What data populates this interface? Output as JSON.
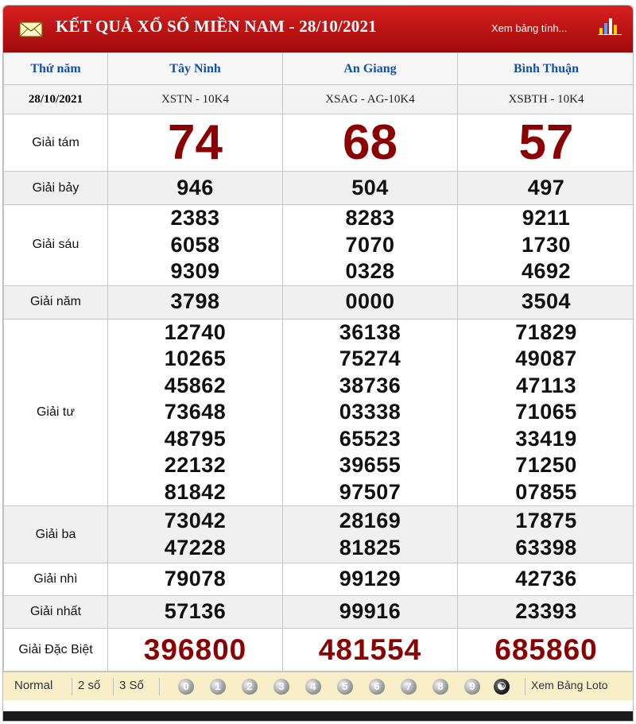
{
  "header": {
    "title": "KẾT QUẢ XỔ SỐ MIỀN NAM - 28/10/2021",
    "link": "Xem bảng tính...",
    "icons": {
      "left": "mail-icon",
      "right": "bar-chart-icon"
    }
  },
  "columns": {
    "day": "Thứ năm",
    "date": "28/10/2021",
    "provinces": [
      {
        "name": "Tây Ninh",
        "code": "XSTN - 10K4"
      },
      {
        "name": "An Giang",
        "code": "XSAG - AG-10K4"
      },
      {
        "name": "Bình Thuận",
        "code": "XSBTH - 10K4"
      }
    ]
  },
  "prizes": {
    "g8": {
      "label": "Giải tám",
      "values": [
        "74",
        "68",
        "57"
      ]
    },
    "g7": {
      "label": "Giải bảy",
      "values": [
        "946",
        "504",
        "497"
      ]
    },
    "g6": {
      "label": "Giải sáu",
      "values": [
        [
          "2383",
          "6058",
          "9309"
        ],
        [
          "8283",
          "7070",
          "0328"
        ],
        [
          "9211",
          "1730",
          "4692"
        ]
      ]
    },
    "g5": {
      "label": "Giải năm",
      "values": [
        "3798",
        "0000",
        "3504"
      ]
    },
    "g4": {
      "label": "Giải tư",
      "values": [
        [
          "12740",
          "10265",
          "45862",
          "73648",
          "48795",
          "22132",
          "81842"
        ],
        [
          "36138",
          "75274",
          "38736",
          "03338",
          "65523",
          "39655",
          "97507"
        ],
        [
          "71829",
          "49087",
          "47113",
          "71065",
          "33419",
          "71250",
          "07855"
        ]
      ]
    },
    "g3": {
      "label": "Giải ba",
      "values": [
        [
          "73042",
          "47228"
        ],
        [
          "28169",
          "81825"
        ],
        [
          "17875",
          "63398"
        ]
      ]
    },
    "g2": {
      "label": "Giải nhì",
      "values": [
        "79078",
        "99129",
        "42736"
      ]
    },
    "g1": {
      "label": "Giải nhất",
      "values": [
        "57136",
        "99916",
        "23393"
      ]
    },
    "db": {
      "label": "Giải Đặc Biệt",
      "values": [
        "396800",
        "481554",
        "685860"
      ]
    }
  },
  "footer": {
    "modes": [
      "Normal",
      "2 số",
      "3 Số"
    ],
    "digits": [
      "0",
      "1",
      "2",
      "3",
      "4",
      "5",
      "6",
      "7",
      "8",
      "9"
    ],
    "loto_link": "Xem Bảng Loto"
  },
  "colors": {
    "header_red": "#c8161d",
    "prize_red": "#8b0000",
    "province_blue": "#1550a8",
    "footer_bg": "#f8eec7"
  }
}
